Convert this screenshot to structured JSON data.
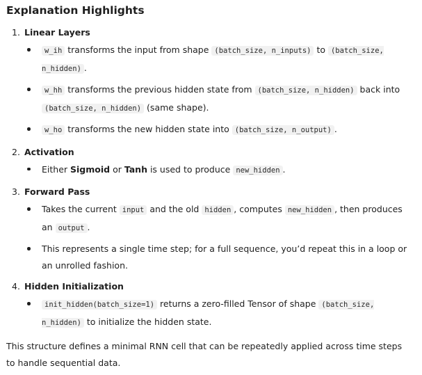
{
  "title": "Explanation Highlights",
  "sections": [
    {
      "num": "1.",
      "title": "Linear Layers",
      "bullets": [
        [
          {
            "c": "w_ih"
          },
          {
            "t": " transforms the input from shape "
          },
          {
            "c": "(batch_size, n_inputs)"
          },
          {
            "t": " to "
          },
          {
            "c": "(batch_size, n_hidden)"
          },
          {
            "t": "."
          }
        ],
        [
          {
            "c": "w_hh"
          },
          {
            "t": " transforms the previous hidden state from "
          },
          {
            "c": "(batch_size, n_hidden)"
          },
          {
            "t": " back into "
          },
          {
            "c": "(batch_size, n_hidden)"
          },
          {
            "t": " (same shape)."
          }
        ],
        [
          {
            "c": "w_ho"
          },
          {
            "t": " transforms the new hidden state into "
          },
          {
            "c": "(batch_size, n_output)"
          },
          {
            "t": "."
          }
        ]
      ]
    },
    {
      "num": "2.",
      "title": "Activation",
      "bullets": [
        [
          {
            "t": "Either "
          },
          {
            "b": "Sigmoid"
          },
          {
            "t": " or "
          },
          {
            "b": "Tanh"
          },
          {
            "t": " is used to produce "
          },
          {
            "c": "new_hidden"
          },
          {
            "t": "."
          }
        ]
      ]
    },
    {
      "num": "3.",
      "title": "Forward Pass",
      "bullets": [
        [
          {
            "t": "Takes the current "
          },
          {
            "c": "input"
          },
          {
            "t": " and the old "
          },
          {
            "c": "hidden"
          },
          {
            "t": ", computes "
          },
          {
            "c": "new_hidden"
          },
          {
            "t": ", then produces an "
          },
          {
            "c": "output"
          },
          {
            "t": "."
          }
        ],
        [
          {
            "t": "This represents a single time step; for a full sequence, you’d repeat this in a loop or an unrolled fashion."
          }
        ]
      ]
    },
    {
      "num": "4.",
      "title": "Hidden Initialization",
      "bullets": [
        [
          {
            "c": "init_hidden(batch_size=1)"
          },
          {
            "t": " returns a zero-filled Tensor of shape "
          },
          {
            "c": "(batch_size, n_hidden)"
          },
          {
            "t": " to initialize the hidden state."
          }
        ]
      ]
    }
  ],
  "outro": "This structure defines a minimal RNN cell that can be repeatedly applied across time steps to handle sequential data."
}
